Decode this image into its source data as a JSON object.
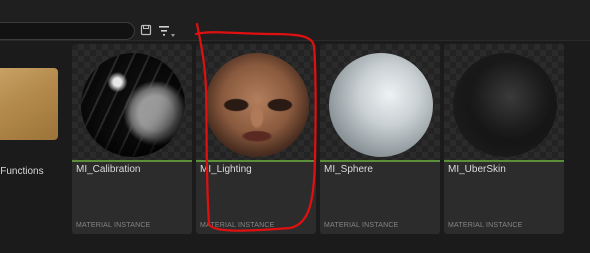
{
  "toolbar": {
    "search": {
      "value": "",
      "placeholder": ""
    },
    "icons": [
      "save-icon",
      "filter-icon"
    ]
  },
  "folders": [
    {
      "label": "lFunctions",
      "color": "#b48a4c"
    }
  ],
  "assets": [
    {
      "name": "MI_Calibration",
      "type": "MATERIAL INSTANCE",
      "thumbnail": "calibration-sphere"
    },
    {
      "name": "MI_Lighting",
      "type": "MATERIAL INSTANCE",
      "thumbnail": "face-sphere"
    },
    {
      "name": "MI_Sphere",
      "type": "MATERIAL INSTANCE",
      "thumbnail": "grey-sphere"
    },
    {
      "name": "MI_UberSkin",
      "type": "MATERIAL INSTANCE",
      "thumbnail": "dark-sphere"
    }
  ],
  "colors": {
    "asset_accent": "#5c8f3a",
    "annotation": "#e01010",
    "background": "#1b1b1b",
    "card": "#2c2c2c"
  }
}
